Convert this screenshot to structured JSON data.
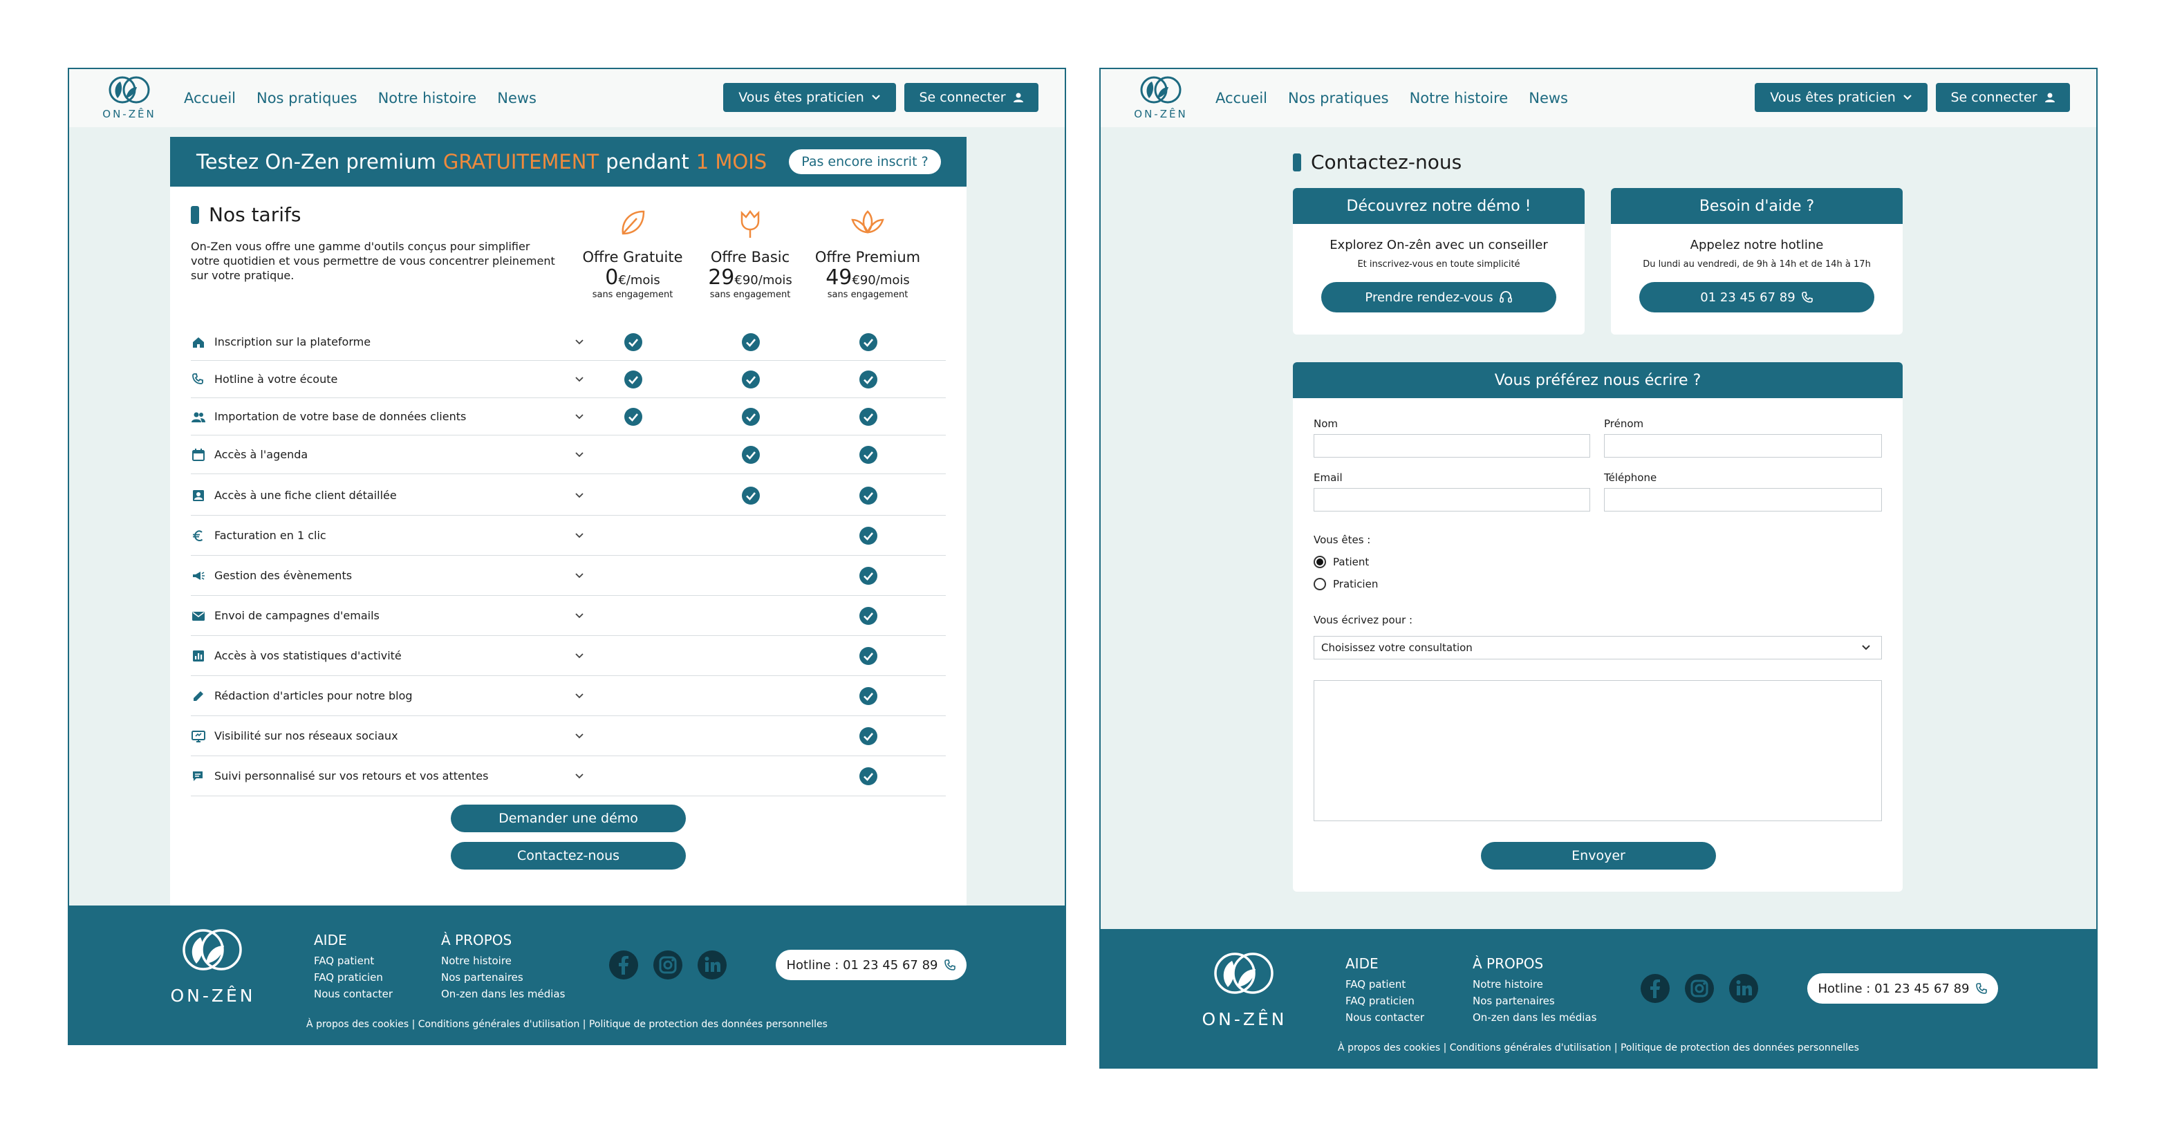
{
  "brand": {
    "logo_text": "ON-ZÊN"
  },
  "colors": {
    "primary": "#1d6a80",
    "accent": "#f08a3c",
    "background": "#e9f2f1"
  },
  "header": {
    "nav": [
      "Accueil",
      "Nos pratiques",
      "Notre histoire",
      "News"
    ],
    "praticien_button": "Vous êtes praticien",
    "login_button": "Se connecter"
  },
  "pricing": {
    "promo": {
      "prefix": "Testez On-Zen premium",
      "highlight": "GRATUITEMENT",
      "middle": "pendant",
      "duration": "1 MOIS",
      "cta": "Pas encore inscrit ?"
    },
    "title": "Nos tarifs",
    "intro": "On-Zen vous offre une gamme d'outils conçus pour simplifier votre quotidien et vous permettre de vous concentrer pleinement sur votre pratique.",
    "plans": [
      {
        "name": "Offre Gratuite",
        "price": "0",
        "cents": "€",
        "period": "/mois",
        "note": "sans engagement",
        "icon": "leaf-icon"
      },
      {
        "name": "Offre Basic",
        "price": "29",
        "cents": "€90",
        "period": "/mois",
        "note": "sans engagement",
        "icon": "tulip-icon"
      },
      {
        "name": "Offre Premium",
        "price": "49",
        "cents": "€90",
        "period": "/mois",
        "note": "sans engagement",
        "icon": "lotus-icon"
      }
    ],
    "features": [
      {
        "label": "Inscription sur la plateforme",
        "icon": "home-icon",
        "included": [
          true,
          true,
          true
        ]
      },
      {
        "label": "Hotline à votre écoute",
        "icon": "phone-icon",
        "included": [
          true,
          true,
          true
        ]
      },
      {
        "label": "Importation de votre base de données clients",
        "icon": "people-icon",
        "included": [
          true,
          true,
          true
        ]
      },
      {
        "label": "Accès à l'agenda",
        "icon": "calendar-icon",
        "included": [
          false,
          true,
          true
        ]
      },
      {
        "label": "Accès à une fiche client détaillée",
        "icon": "contact-card-icon",
        "included": [
          false,
          true,
          true
        ]
      },
      {
        "label": "Facturation en 1 clic",
        "icon": "euro-icon",
        "included": [
          false,
          false,
          true
        ]
      },
      {
        "label": "Gestion des évènements",
        "icon": "megaphone-icon",
        "included": [
          false,
          false,
          true
        ]
      },
      {
        "label": "Envoi de campagnes d'emails",
        "icon": "mail-icon",
        "included": [
          false,
          false,
          true
        ]
      },
      {
        "label": "Accès à vos statistiques d'activité",
        "icon": "stats-icon",
        "included": [
          false,
          false,
          true
        ]
      },
      {
        "label": "Rédaction d'articles pour notre blog",
        "icon": "pencil-icon",
        "included": [
          false,
          false,
          true
        ]
      },
      {
        "label": "Visibilité sur nos réseaux sociaux",
        "icon": "screen-icon",
        "included": [
          false,
          false,
          true
        ]
      },
      {
        "label": "Suivi personnalisé sur vos retours et vos attentes",
        "icon": "chat-icon",
        "included": [
          false,
          false,
          true
        ]
      }
    ],
    "demo_button": "Demander une démo",
    "contact_button": "Contactez-nous"
  },
  "contact": {
    "title": "Contactez-nous",
    "demo_card": {
      "header": "Découvrez notre démo !",
      "title": "Explorez On-zên avec un conseiller",
      "subtitle": "Et inscrivez-vous en toute simplicité",
      "button": "Prendre rendez-vous"
    },
    "help_card": {
      "header": "Besoin d'aide ?",
      "title": "Appelez notre hotline",
      "subtitle": "Du lundi au vendredi, de 9h à 14h et de 14h à 17h",
      "button": "01 23 45 67 89"
    },
    "form": {
      "header": "Vous préférez nous écrire ?",
      "nom_label": "Nom",
      "prenom_label": "Prénom",
      "email_label": "Email",
      "telephone_label": "Téléphone",
      "vous_etes_label": "Vous êtes :",
      "radio_options": [
        "Patient",
        "Praticien"
      ],
      "radio_selected": "Patient",
      "purpose_label": "Vous écrivez pour :",
      "select_value": "Choisissez votre consultation",
      "submit_button": "Envoyer"
    }
  },
  "footer": {
    "logo_text": "ON-ZÊN",
    "aide": {
      "title": "AIDE",
      "links": [
        "FAQ patient",
        "FAQ praticien",
        "Nous contacter"
      ]
    },
    "apropos": {
      "title": "À PROPOS",
      "links": [
        "Notre histoire",
        "Nos partenaires",
        "On-zen dans les médias"
      ]
    },
    "socials": [
      "facebook-icon",
      "instagram-icon",
      "linkedin-icon"
    ],
    "hotline": "Hotline : 01 23 45 67 89",
    "legal": "À propos des cookies | Conditions générales d'utilisation | Politique de protection des données personnelles"
  }
}
